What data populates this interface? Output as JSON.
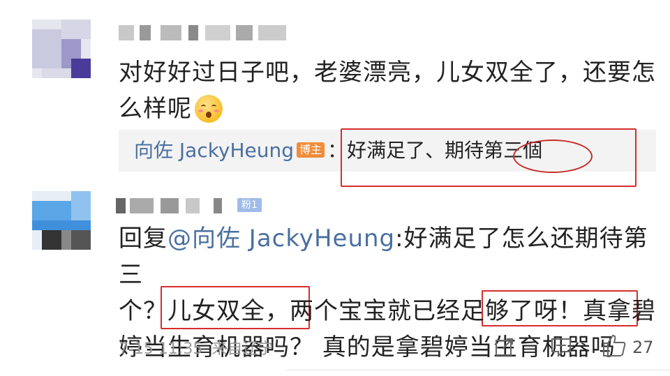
{
  "comment1": {
    "text_line1": "对好好过日子吧，老婆漂亮，儿女双全了，还要怎",
    "text_line2": "么样呢",
    "emoji": "flushed-face-emoji"
  },
  "reply_preview": {
    "author": "向佐 JackyHeung",
    "badge": "博主",
    "text": "：好满足了、期待第三個"
  },
  "comment2": {
    "fan_badge": "粉1",
    "reply_prefix": "回复",
    "mention": "@向佐 JackyHeung",
    "line1_rest": ":好满足了怎么还期待第三",
    "line2": "个？儿女双全，两个宝宝就已经足够了呀！真拿碧",
    "line3": "婷当生育机器吗？ 真的是拿碧婷当生育机器吗",
    "timestamp": "7-15 11:35",
    "location": "来自辽宁",
    "like_count": "27"
  },
  "colors": {
    "link": "#4a6fa0",
    "highlight_box": "#d62c2c",
    "badge": "#f08c3a"
  },
  "icons": [
    "share-icon",
    "comment-icon",
    "like-icon"
  ]
}
